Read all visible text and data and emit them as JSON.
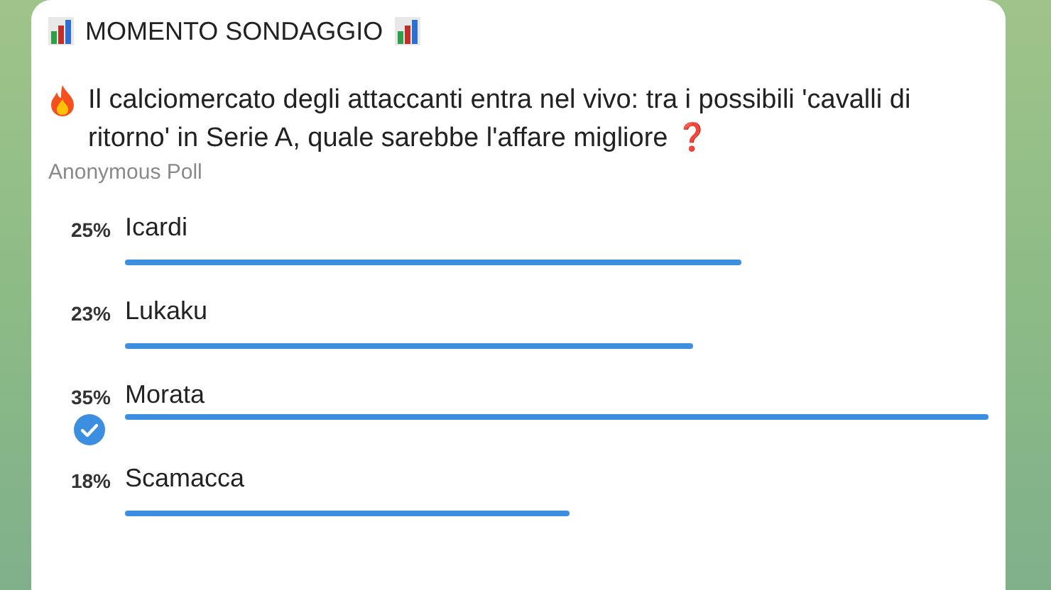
{
  "header": {
    "title": "MOMENTO SONDAGGIO"
  },
  "question": "Il calciomercato degli attaccanti entra nel vivo: tra i possibili 'cavalli di ritorno' in Serie A, quale sarebbe l'affare migliore",
  "question_emoji": "❓",
  "poll_type": "Anonymous Poll",
  "options": [
    {
      "percent": "25%",
      "label": "Icardi",
      "selected": false
    },
    {
      "percent": "23%",
      "label": "Lukaku",
      "selected": false
    },
    {
      "percent": "35%",
      "label": "Morata",
      "selected": true
    },
    {
      "percent": "18%",
      "label": "Scamacca",
      "selected": false
    }
  ]
}
